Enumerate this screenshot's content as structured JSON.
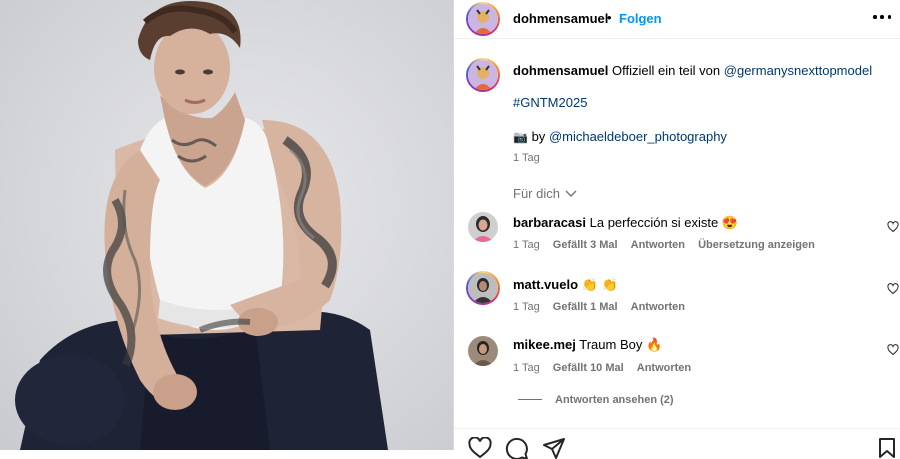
{
  "post": {
    "author": "dohmensamuel",
    "separator": "•",
    "follow_label": "Folgen",
    "caption_author": "dohmensamuel",
    "caption_text": "Offiziell ein teil von",
    "caption_mention": "@germanysnexttopmodel",
    "hashtag": "#GNTM2025",
    "camera_emoji": "📷",
    "by_text": "by",
    "photographer": "@michaeldeboer_photography",
    "caption_time": "1 Tag"
  },
  "comments_header": {
    "sort_label": "Für dich"
  },
  "comments": [
    {
      "username": "barbaracasi",
      "text": "La perfección si existe",
      "emoji": "😍",
      "time": "1 Tag",
      "likes": "Gefällt 3 Mal",
      "reply": "Antworten",
      "translate": "Übersetzung anzeigen"
    },
    {
      "username": "matt.vuelo",
      "text": "",
      "emoji": "👏 👏",
      "time": "1 Tag",
      "likes": "Gefällt 1 Mal",
      "reply": "Antworten"
    },
    {
      "username": "mikee.mej",
      "text": "Traum Boy",
      "emoji": "🔥",
      "time": "1 Tag",
      "likes": "Gefällt 10 Mal",
      "reply": "Antworten",
      "view_replies": "Antworten ansehen (2)"
    }
  ],
  "colors": {
    "link": "#00376b",
    "follow": "#0095f6",
    "meta": "#737373",
    "border": "#dbdbdb"
  }
}
